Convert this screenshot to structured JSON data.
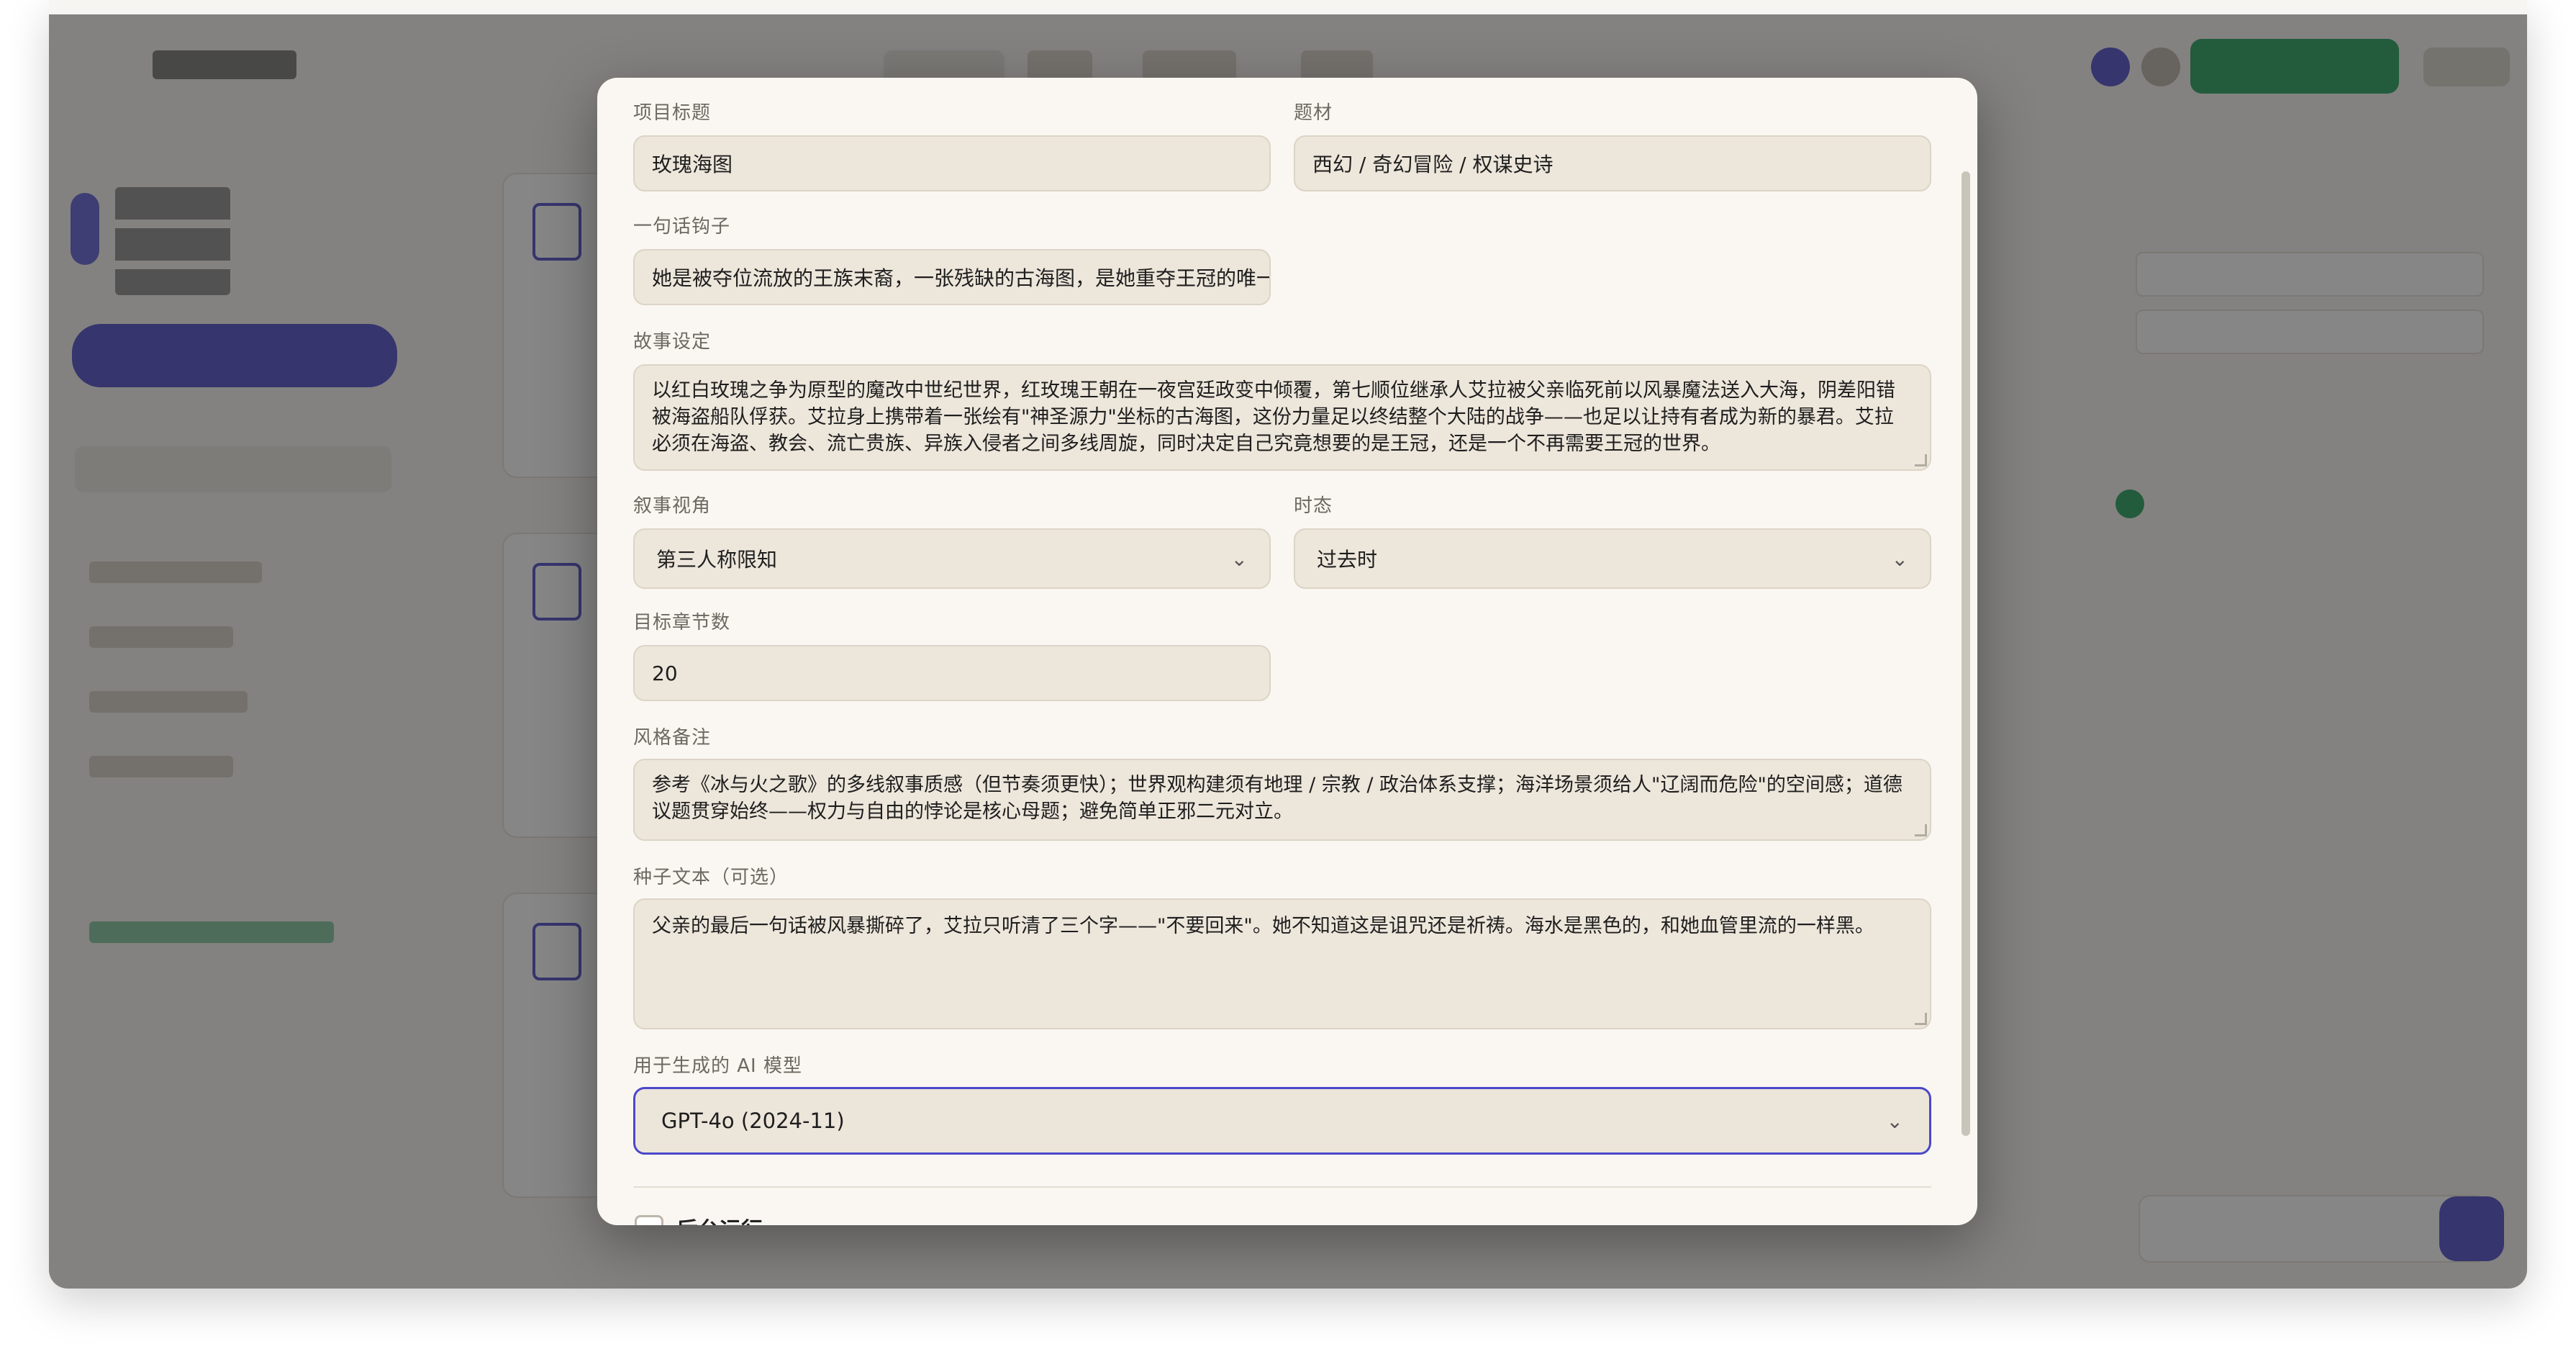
{
  "modal": {
    "fields": {
      "project_title": {
        "label": "项目标题",
        "value": "玫瑰海图"
      },
      "genre": {
        "label": "题材",
        "value": "西幻 / 奇幻冒险 / 权谋史诗"
      },
      "hook": {
        "label": "一句话钩子",
        "value": "她是被夺位流放的王族末裔，一张残缺的古海图，是她重夺王冠的唯一线"
      },
      "setting": {
        "label": "故事设定",
        "value": "以红白玫瑰之争为原型的魔改中世纪世界，红玫瑰王朝在一夜宫廷政变中倾覆，第七顺位继承人艾拉被父亲临死前以风暴魔法送入大海，阴差阳错被海盗船队俘获。艾拉身上携带着一张绘有\"神圣源力\"坐标的古海图，这份力量足以终结整个大陆的战争——也足以让持有者成为新的暴君。艾拉必须在海盗、教会、流亡贵族、异族入侵者之间多线周旋，同时决定自己究竟想要的是王冠，还是一个不再需要王冠的世界。"
      },
      "pov": {
        "label": "叙事视角",
        "value": "第三人称限知"
      },
      "tense": {
        "label": "时态",
        "value": "过去时"
      },
      "chapters": {
        "label": "目标章节数",
        "value": "20"
      },
      "style": {
        "label": "风格备注",
        "value": "参考《冰与火之歌》的多线叙事质感（但节奏须更快）；世界观构建须有地理 / 宗教 / 政治体系支撑；海洋场景须给人\"辽阔而危险\"的空间感；道德议题贯穿始终——权力与自由的悖论是核心母题；避免简单正邪二元对立。"
      },
      "seed": {
        "label": "种子文本（可选）",
        "value": "父亲的最后一句话被风暴撕碎了，艾拉只听清了三个字——\"不要回来\"。她不知道这是诅咒还是祈祷。海水是黑色的，和她血管里流的一样黑。"
      },
      "model": {
        "label": "用于生成的 AI 模型",
        "value": "GPT-4o (2024-11)"
      }
    },
    "background_run_label": "后台运行"
  },
  "icons": {
    "chevron": "chevron-down-icon"
  },
  "colors": {
    "accent": "#4a48c9",
    "modal_bg": "#faf7f2",
    "input_bg": "#ede6db",
    "success": "#1f9d5a"
  }
}
